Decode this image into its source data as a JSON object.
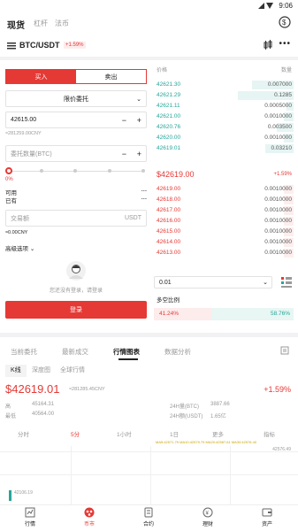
{
  "status": {
    "time": "9:06"
  },
  "topnav": {
    "tabs": [
      "现货",
      "杠杆",
      "法币"
    ]
  },
  "pair": {
    "name": "BTC/USDT",
    "change": "+1.59%"
  },
  "trade": {
    "buy": "买入",
    "sell": "卖出",
    "order_type": "限价委托",
    "price": "42615.00",
    "price_cny": "≈281259.00CNY",
    "amount_placeholder": "委托数量(BTC)",
    "pct0": "0%",
    "available_label": "可用",
    "held_label": "已有",
    "available_value": "---",
    "held_value": "---",
    "total_placeholder": "交易额",
    "total_unit": "USDT",
    "total_cny": "≈0.00CNY",
    "advanced": "高级选项",
    "login_prompt": "您还没有登录，请登录",
    "login_button": "登录"
  },
  "orderbook": {
    "price_header": "价格",
    "qty_header": "数量",
    "asks": [
      {
        "price": "42621.30",
        "qty": "0.007000",
        "depth": 0.3
      },
      {
        "price": "42621.29",
        "qty": "0.1285",
        "depth": 0.4
      },
      {
        "price": "42621.11",
        "qty": "0.0005000",
        "depth": 0.05
      },
      {
        "price": "42621.00",
        "qty": "0.0010000",
        "depth": 0.07
      },
      {
        "price": "42620.76",
        "qty": "0.003500",
        "depth": 0.12
      },
      {
        "price": "42620.00",
        "qty": "0.0010000",
        "depth": 0.07
      },
      {
        "price": "42619.01",
        "qty": "0.03210",
        "depth": 0.2
      }
    ],
    "last": "$42619.00",
    "last_change": "+1.59%",
    "bids": [
      {
        "price": "42619.00",
        "qty": "0.0010000",
        "depth": 0.07
      },
      {
        "price": "42618.00",
        "qty": "0.0010000",
        "depth": 0.07
      },
      {
        "price": "42617.00",
        "qty": "0.0010000",
        "depth": 0.07
      },
      {
        "price": "42616.00",
        "qty": "0.0010000",
        "depth": 0.07
      },
      {
        "price": "42615.00",
        "qty": "0.0010000",
        "depth": 0.07
      },
      {
        "price": "42614.00",
        "qty": "0.0010000",
        "depth": 0.07
      },
      {
        "price": "42613.00",
        "qty": "0.0010000",
        "depth": 0.07
      }
    ],
    "precision": "0.01",
    "ratio_label": "多空比例",
    "long_pct": "41.24%",
    "short_pct": "58.76%",
    "long_fraction": 0.4124
  },
  "section_tabs": [
    "当前委托",
    "最新成交",
    "行情图表",
    "数据分析"
  ],
  "sub_tabs": [
    "K线",
    "深度图",
    "全球行情"
  ],
  "ticker": {
    "price": "$42619.01",
    "cny": "≈281285.45CNY",
    "change": "+1.59%",
    "high_label": "高",
    "high": "45164.31",
    "low_label": "最低",
    "low": "40564.00",
    "vol_label": "24H量(BTC)",
    "vol": "3887.66",
    "amt_label": "24H额(USDT)",
    "amt": "1.65亿"
  },
  "intervals": [
    "分时",
    "5分",
    "1小时",
    "1日",
    "更多",
    "指标"
  ],
  "chart": {
    "ma_labels": "MA5:42571.79  MA10:42579.79  MA20:42587.61  MA30:42576.40",
    "high_mark": "42576.49",
    "low_mark": "42106.19"
  },
  "bottomnav": [
    "行情",
    "币市",
    "合约",
    "理财",
    "资产"
  ]
}
